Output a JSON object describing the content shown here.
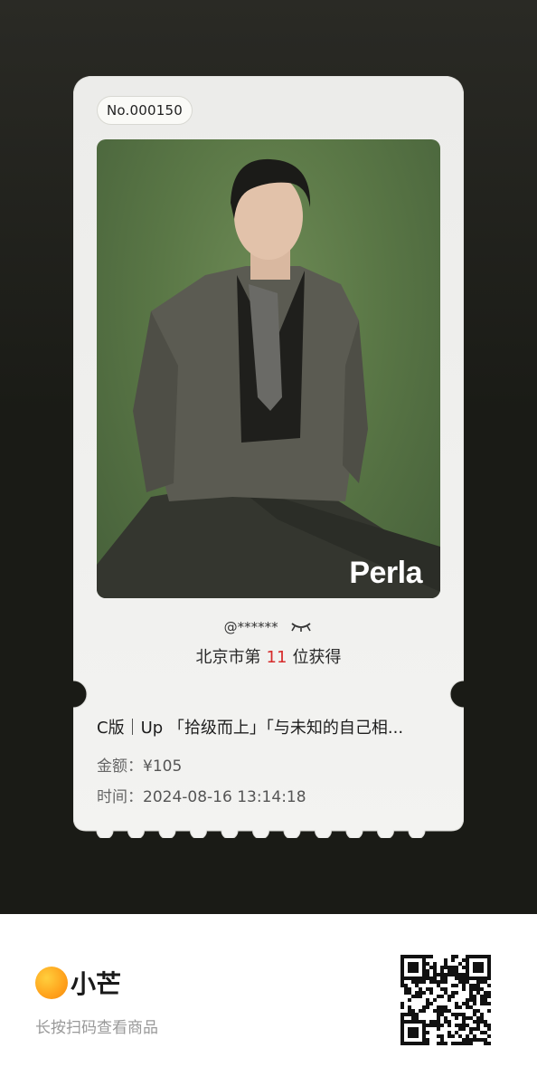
{
  "ticket": {
    "serial_number": "No.000150",
    "photo_brand": "Perla",
    "owner_handle": "@******",
    "rank_prefix": "北京市第",
    "rank_number": "11",
    "rank_suffix": "位获得",
    "product_name": "C版｜Up 「拾级而上」「与未知的自己相...",
    "amount_label": "金额：",
    "amount_value": "¥105",
    "time_label": "时间：",
    "time_value": "2024-08-16 13:14:18"
  },
  "footer": {
    "app_name": "小芒",
    "scan_tip": "长按扫码查看商品"
  },
  "icons": {
    "eye": "closed-eye-icon",
    "logo": "xiaomang-logo-icon",
    "qr": "qr-code"
  },
  "colors": {
    "rank_highlight": "#d62b2b",
    "logo_orange": "#ffa21c",
    "backdrop": "#1a1b16",
    "photo_green": "#5a7746"
  }
}
